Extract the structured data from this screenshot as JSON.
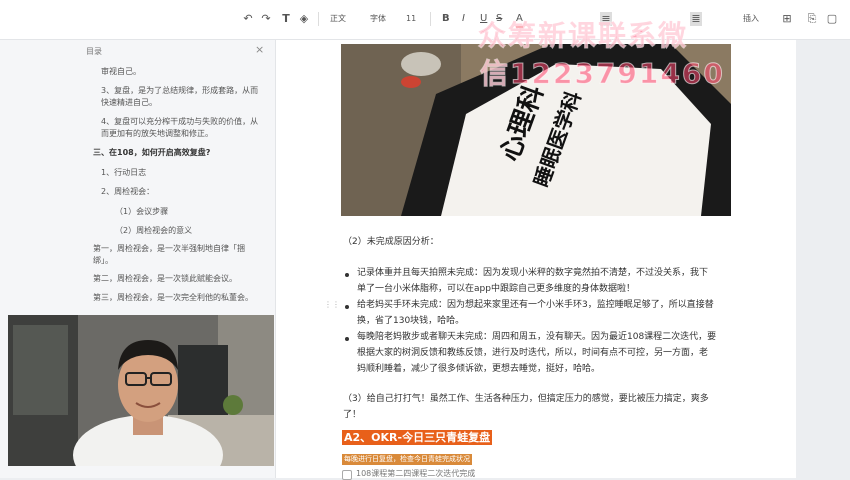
{
  "toolbar": {
    "undo_icon": "undo-icon",
    "redo_icon": "redo-icon",
    "format_painter_icon": "format-painter-icon",
    "clear_format_icon": "eraser-icon",
    "style_label": "正文",
    "font_label": "字体",
    "size_label": "11",
    "bold": "B",
    "italic": "I",
    "underline": "U",
    "strike": "S",
    "color": "A",
    "insert_label": "插入"
  },
  "watermark": {
    "line1": "众筹新课联系微",
    "line2": "信1223791460"
  },
  "sidebar": {
    "title": "目录",
    "items": [
      "审视自己。",
      "3、复盘，是为了总结规律，形成套路，从而",
      "快速精进自己。",
      "4、复盘可以充分榨干成功与失败的价值，从",
      "而更加有的放矢地调整和修正。",
      "三、在108，如何开启高效复盘?",
      "1、行动日志",
      "2、周检视会：",
      "（1）会议步骤",
      "（2）周检视会的意义",
      "第一，周检视会，是一次半强制地自律「捆",
      "绑」。",
      "第二，周检视会，是一次锁此赋能会议。",
      "第三，周检视会，是一次完全利他的私董会。"
    ]
  },
  "photo": {
    "sign_line1": "心理科",
    "sign_line2": "睡眠医学科"
  },
  "content": {
    "section_heading": "（2）未完成原因分析：",
    "bullet1_l1": "记录体重并且每天拍照未完成：因为发现小米秤的数字竟然拍不清楚，不过没关系，我下",
    "bullet1_l2": "单了一台小米体脂称，可以在app中跟踪自己更多维度的身体数据啦！",
    "bullet2_l1": "给老妈买手环未完成：因为想起来家里还有一个小米手环3，监控睡眠足够了，所以直接替",
    "bullet2_l2": "换，省了130块钱，哈哈。",
    "bullet3_l1": "每晚陪老妈散步或者聊天未完成：周四和周五，没有聊天。因为最近108课程二次迭代，要",
    "bullet3_l2": "根据大家的树洞反馈和教练反馈，进行及时迭代，所以，时间有点不可控，另一方面，老",
    "bullet3_l3": "妈顺利睡着，减少了很多倾诉欲，更想去睡觉，挺好，哈哈。",
    "para3_l1": "（3）给自己打打气！虽然工作、生活各种压力，但搞定压力的感觉，要比被压力搞定，爽多",
    "para3_l2": "了！",
    "heading_a2": "A2、OKR-今日三只青蛙复盘",
    "sub_heading": "每晚进行日复盘，检查今日青蛙完成状况",
    "task1": "108课程第二四课程二次迭代完成"
  }
}
